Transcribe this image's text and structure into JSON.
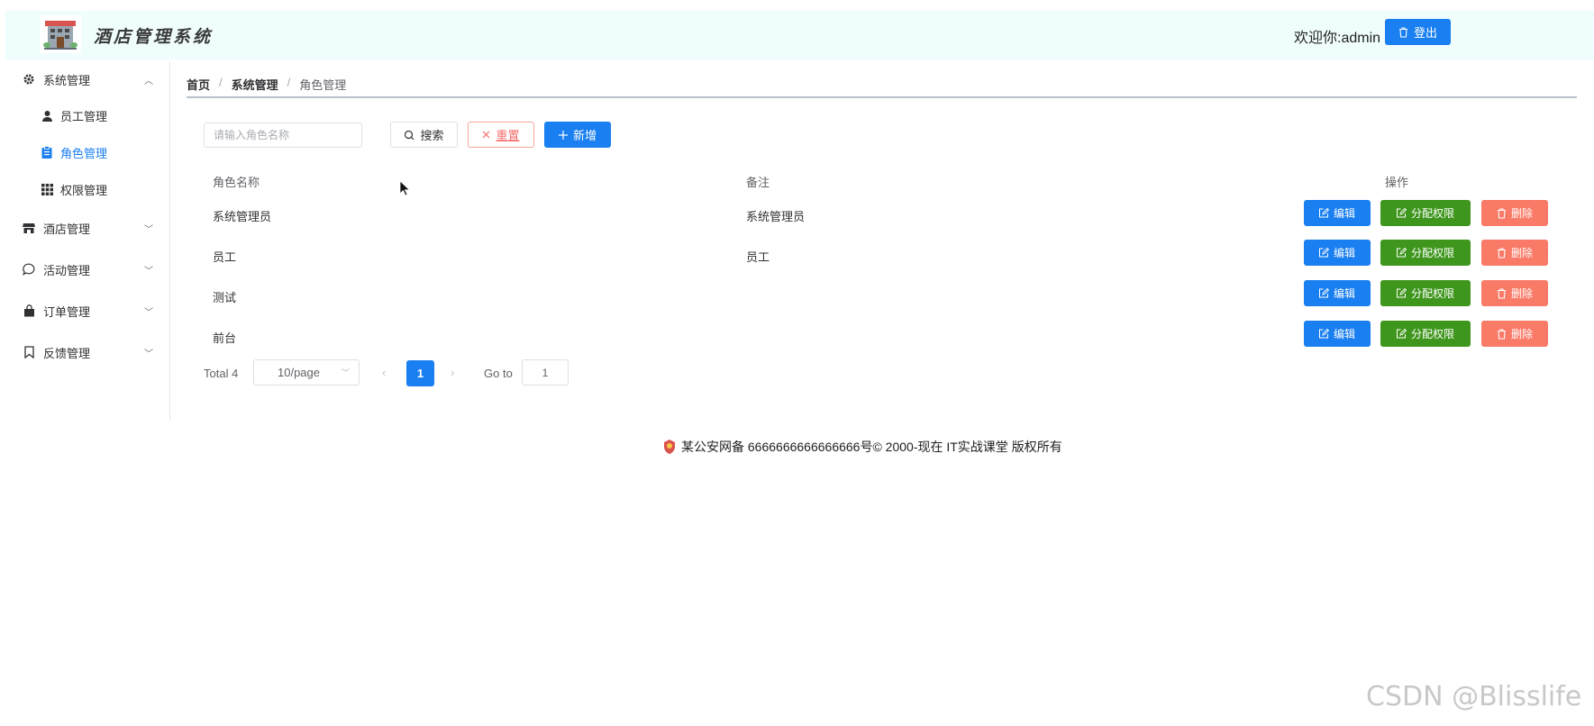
{
  "header": {
    "title": "酒店管理系统",
    "welcome": "欢迎你:admin",
    "logout_label": "登出"
  },
  "sidebar": {
    "groups": [
      {
        "label": "系统管理",
        "icon": "gear-icon",
        "expanded": true
      },
      {
        "label": "酒店管理",
        "icon": "store-icon",
        "expanded": false
      },
      {
        "label": "活动管理",
        "icon": "chat-icon",
        "expanded": false
      },
      {
        "label": "订单管理",
        "icon": "bag-icon",
        "expanded": false
      },
      {
        "label": "反馈管理",
        "icon": "bookmark-icon",
        "expanded": false
      }
    ],
    "sub_items": [
      {
        "label": "员工管理",
        "icon": "user-icon"
      },
      {
        "label": "角色管理",
        "icon": "clipboard-icon",
        "active": true
      },
      {
        "label": "权限管理",
        "icon": "grid-icon"
      }
    ]
  },
  "breadcrumb": {
    "home": "首页",
    "section": "系统管理",
    "current": "角色管理",
    "separator": "/"
  },
  "toolbar": {
    "search_placeholder": "请输入角色名称",
    "search_label": "搜索",
    "reset_label": "重置",
    "add_label": "新增"
  },
  "table": {
    "headers": {
      "name": "角色名称",
      "remark": "备注",
      "actions": "操作"
    },
    "rows": [
      {
        "name": "系统管理员",
        "remark": "系统管理员"
      },
      {
        "name": "员工",
        "remark": "员工"
      },
      {
        "name": "测试",
        "remark": ""
      },
      {
        "name": "前台",
        "remark": ""
      }
    ],
    "edit_label": "编辑",
    "assign_label": "分配权限",
    "delete_label": "删除"
  },
  "pagination": {
    "total": "Total 4",
    "page_size": "10/page",
    "current_page": "1",
    "goto_label": "Go to",
    "goto_value": "1"
  },
  "footer": {
    "text": "某公安网备 6666666666666666号© 2000-现在 IT实战课堂 版权所有"
  },
  "watermark": "CSDN @Blisslife",
  "colors": {
    "primary": "#1a7ff0",
    "success": "#3f961d",
    "danger": "#f97a67",
    "header_bg": "#f0fdfd"
  }
}
